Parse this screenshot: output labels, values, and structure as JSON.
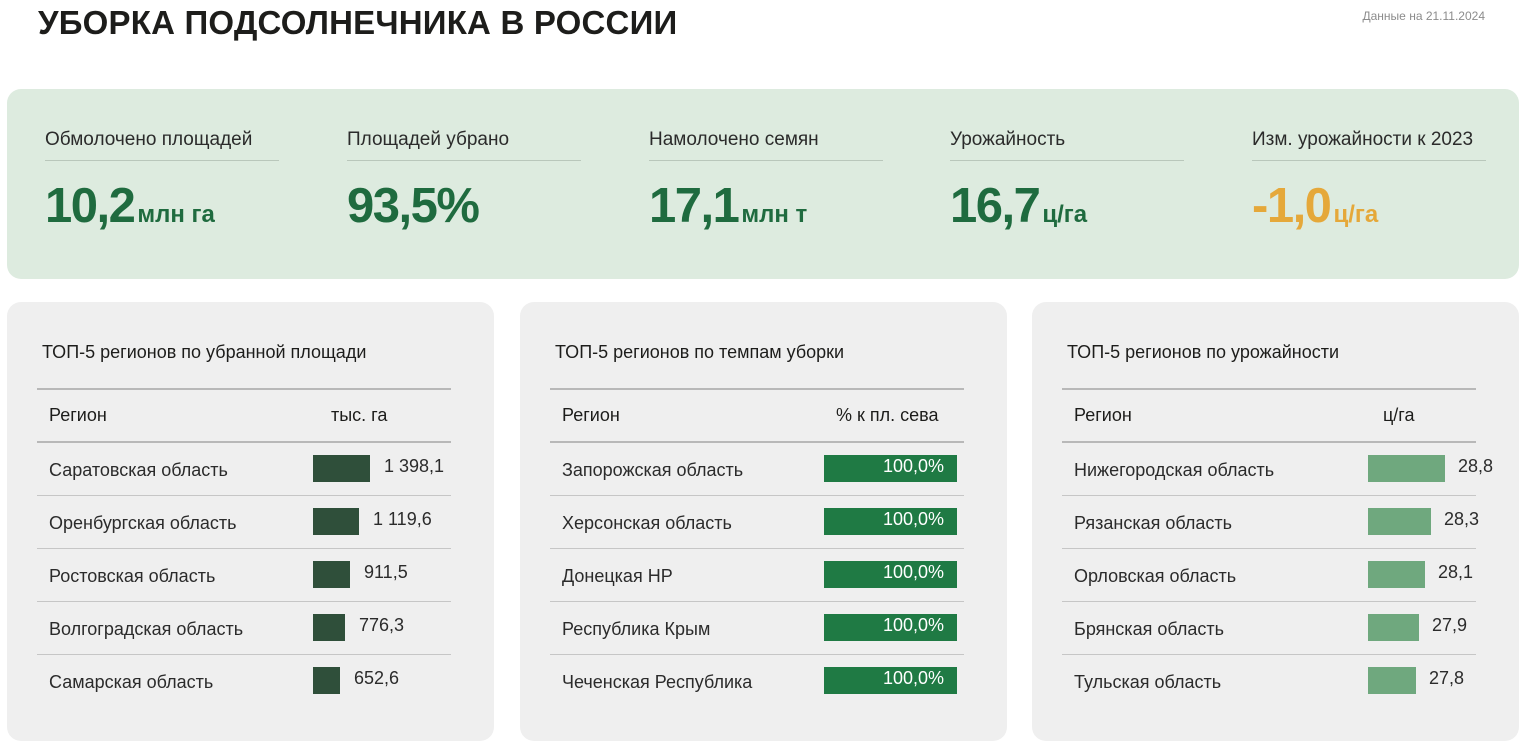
{
  "header": {
    "title": "УБОРКА ПОДСОЛНЕЧНИКА В РОССИИ",
    "date": "Данные на 21.11.2024"
  },
  "kpis": [
    {
      "label": "Обмолочено площадей",
      "value": "10,2",
      "unit": "млн га"
    },
    {
      "label": "Площадей убрано",
      "value": "93,5%",
      "unit": ""
    },
    {
      "label": "Намолочено семян",
      "value": "17,1",
      "unit": "млн т"
    },
    {
      "label": "Урожайность",
      "value": "16,7",
      "unit": "ц/га"
    },
    {
      "label": "Изм. урожайности к 2023",
      "value": "-1,0",
      "unit": "ц/га"
    }
  ],
  "colors": {
    "kpi_value": "#1f6b3f",
    "kpi_negative": "#e5a83a",
    "area_bar": "#2f4f3a",
    "pace_bar": "#1f7a44",
    "yield_bar": "#6fa87e",
    "banner_bg": "#ddebdf",
    "panel_bg": "#efefef"
  },
  "chart_data": [
    {
      "type": "bar",
      "title": "ТОП-5 регионов по убранной площади",
      "column_headers": [
        "Регион",
        "тыс. га"
      ],
      "categories": [
        "Саратовская область",
        "Оренбургская область",
        "Ростовская область",
        "Волгоградская область",
        "Самарская область"
      ],
      "values": [
        1398.1,
        1119.6,
        911.5,
        776.3,
        652.6
      ],
      "labels": [
        "1 398,1",
        "1 119,6",
        "911,5",
        "776,3",
        "652,6"
      ]
    },
    {
      "type": "bar",
      "title": "ТОП-5 регионов по темпам уборки",
      "column_headers": [
        "Регион",
        "% к пл. сева"
      ],
      "categories": [
        "Запорожская область",
        "Херсонская область",
        "Донецкая НР",
        "Республика Крым",
        "Чеченская Республика"
      ],
      "values": [
        100.0,
        100.0,
        100.0,
        100.0,
        100.0
      ],
      "labels": [
        "100,0%",
        "100,0%",
        "100,0%",
        "100,0%",
        "100,0%"
      ]
    },
    {
      "type": "bar",
      "title": "ТОП-5 регионов по урожайности",
      "column_headers": [
        "Регион",
        "ц/га"
      ],
      "categories": [
        "Нижегородская область",
        "Рязанская область",
        "Орловская область",
        "Брянская область",
        "Тульская область"
      ],
      "values": [
        28.8,
        28.3,
        28.1,
        27.9,
        27.8
      ],
      "labels": [
        "28,8",
        "28,3",
        "28,1",
        "27,9",
        "27,8"
      ]
    }
  ]
}
